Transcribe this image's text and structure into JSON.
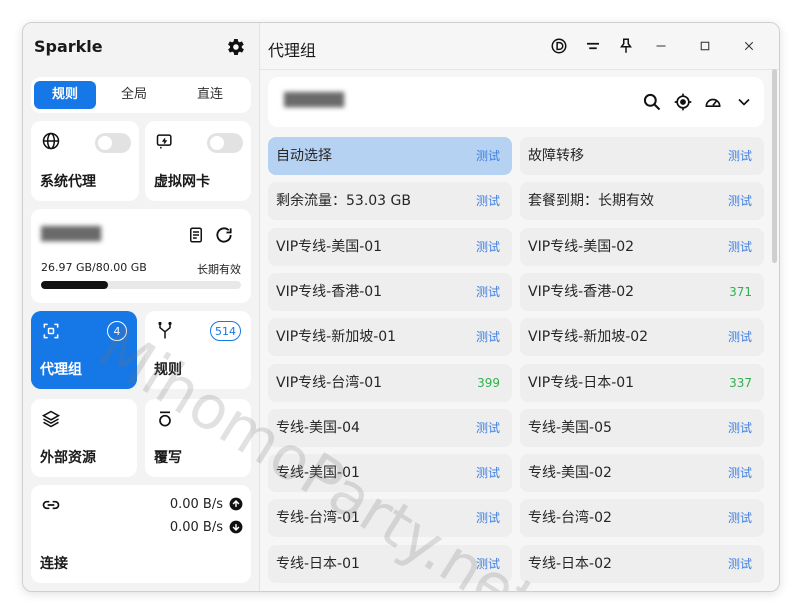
{
  "app": {
    "title": "Sparkle"
  },
  "mode_tabs": [
    {
      "label": "规则",
      "active": true
    },
    {
      "label": "全局",
      "active": false
    },
    {
      "label": "直连",
      "active": false
    }
  ],
  "cards": {
    "system_proxy": {
      "label": "系统代理",
      "icon": "globe-icon",
      "enabled": false
    },
    "tun": {
      "label": "虚拟网卡",
      "icon": "network-card-icon",
      "enabled": false
    },
    "profile": {
      "name": "██████",
      "usage": "26.97 GB/80.00 GB",
      "expiry": "长期有效",
      "usage_fraction": 0.337
    },
    "proxy_groups": {
      "label": "代理组",
      "count": "4"
    },
    "rules": {
      "label": "规则",
      "count": "514"
    },
    "resources": {
      "label": "外部资源"
    },
    "override": {
      "label": "覆写"
    },
    "connections": {
      "label": "连接",
      "upload": "0.00 B/s",
      "download": "0.00 B/s"
    }
  },
  "main": {
    "title": "代理组",
    "search_text": "██████",
    "proxies": [
      {
        "name": "自动选择",
        "status": "测试",
        "selected": true
      },
      {
        "name": "故障转移",
        "status": "测试"
      },
      {
        "name": "剩余流量：53.03 GB",
        "status": "测试"
      },
      {
        "name": "套餐到期：长期有效",
        "status": "测试"
      },
      {
        "name": "VIP专线-美国-01",
        "status": "测试"
      },
      {
        "name": "VIP专线-美国-02",
        "status": "测试"
      },
      {
        "name": "VIP专线-香港-01",
        "status": "测试"
      },
      {
        "name": "VIP专线-香港-02",
        "status": "371",
        "ok": true
      },
      {
        "name": "VIP专线-新加坡-01",
        "status": "测试"
      },
      {
        "name": "VIP专线-新加坡-02",
        "status": "测试"
      },
      {
        "name": "VIP专线-台湾-01",
        "status": "399",
        "ok": true
      },
      {
        "name": "VIP专线-日本-01",
        "status": "337",
        "ok": true
      },
      {
        "name": "专线-美国-04",
        "status": "测试"
      },
      {
        "name": "专线-美国-05",
        "status": "测试"
      },
      {
        "name": "专线-美国-01",
        "status": "测试"
      },
      {
        "name": "专线-美国-02",
        "status": "测试"
      },
      {
        "name": "专线-台湾-01",
        "status": "测试"
      },
      {
        "name": "专线-台湾-02",
        "status": "测试"
      },
      {
        "name": "专线-日本-01",
        "status": "测试"
      },
      {
        "name": "专线-日本-02",
        "status": "测试"
      }
    ]
  },
  "watermark": "MihomoParty.net",
  "colors": {
    "accent": "#1677e6",
    "latency_ok": "#2fb14e",
    "test_link": "#3d7fe0"
  }
}
